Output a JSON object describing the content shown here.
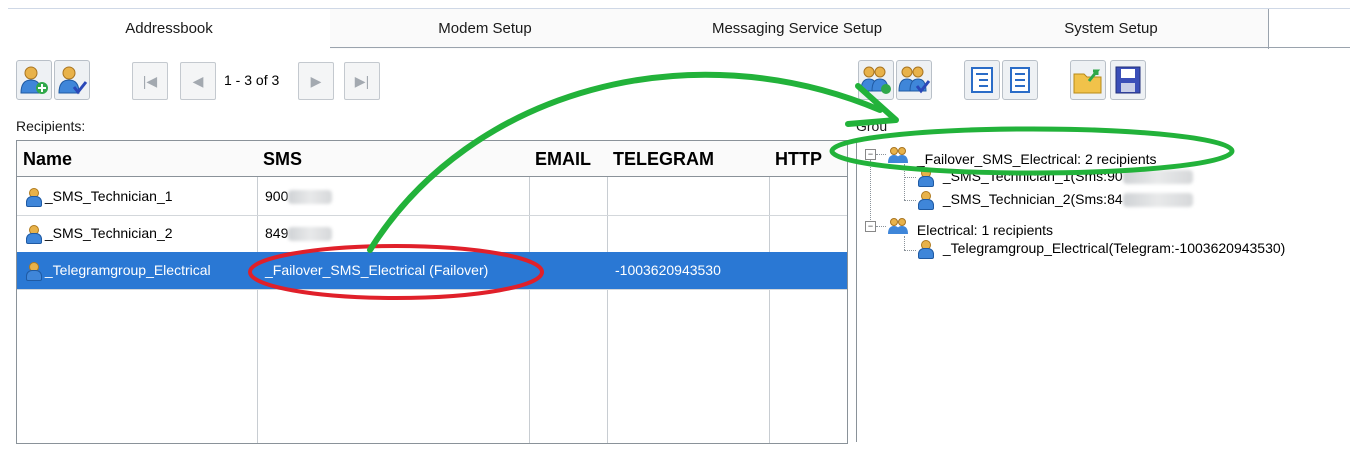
{
  "tabs": [
    "Addressbook",
    "Modem Setup",
    "Messaging Service Setup",
    "System Setup"
  ],
  "pager": {
    "text": "1 - 3 of 3"
  },
  "labels": {
    "recipients": "Recipients:",
    "groups": "Grou"
  },
  "grid": {
    "columns": [
      "Name",
      "SMS",
      "EMAIL",
      "TELEGRAM",
      "HTTP"
    ],
    "rows": [
      {
        "name": "_SMS_Technician_1",
        "sms": "900",
        "email": "",
        "telegram": "",
        "http": ""
      },
      {
        "name": "_SMS_Technician_2",
        "sms": "849",
        "email": "",
        "telegram": "",
        "http": ""
      },
      {
        "name": "_Telegramgroup_Electrical",
        "sms": "_Failover_SMS_Electrical (Failover)",
        "email": "",
        "telegram": "-1003620943530",
        "http": ""
      }
    ]
  },
  "tree": {
    "group1": "_Failover_SMS_Electrical: 2 recipients",
    "g1_items": [
      "_SMS_Technician_1(Sms:90",
      "_SMS_Technician_2(Sms:84"
    ],
    "group2": "Electrical: 1 recipients",
    "g2_items": [
      "_Telegramgroup_Electrical(Telegram:-1003620943530)"
    ]
  },
  "colors": {
    "selection": "#2a78d4",
    "red_annotation": "#e0202a",
    "green_annotation": "#22b23a"
  },
  "icons": [
    "add-recipient-icon",
    "edit-recipient-icon",
    "first-page-icon",
    "prev-page-icon",
    "next-page-icon",
    "last-page-icon",
    "add-group-icon",
    "edit-group-icon",
    "expand-tree-icon",
    "collapse-tree-icon",
    "open-folder-icon",
    "save-icon"
  ]
}
